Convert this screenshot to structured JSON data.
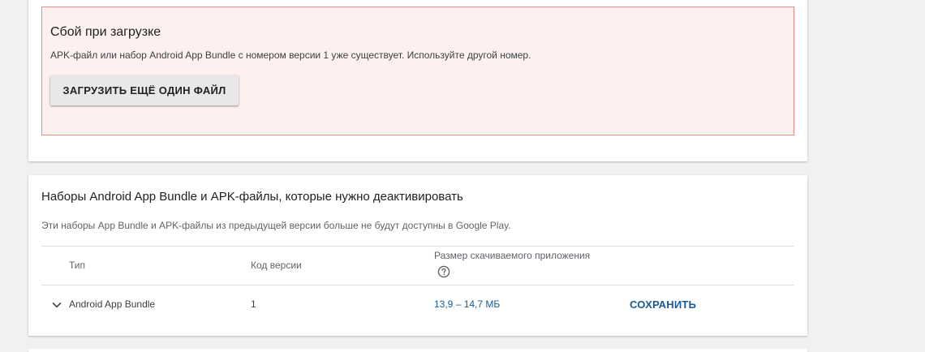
{
  "error": {
    "title": "Сбой при загрузке",
    "message": "APK-файл или набор Android App Bundle с номером версии 1 уже существует. Используйте другой номер.",
    "upload_button_label": "ЗАГРУЗИТЬ ЕЩЁ ОДИН ФАЙЛ",
    "border_color": "#e88d87",
    "background_color": "#fdf0ef"
  },
  "deactivate_section": {
    "title": "Наборы Android App Bundle и APK-файлы, которые нужно деактивировать",
    "description": "Эти наборы App Bundle и APK-файлы из предыдущей версии больше не будут доступны в Google Play.",
    "columns": {
      "type": "Тип",
      "version_code": "Код версии",
      "download_size": "Размер скачиваемого приложения"
    },
    "help_icon": "help-circle-icon",
    "rows": [
      {
        "type": "Android App Bundle",
        "version_code": "1",
        "download_size": "13,9 – 14,7 МБ",
        "action": "СОХРАНИТЬ",
        "expand_icon": "chevron-down-icon"
      }
    ]
  },
  "colors": {
    "link": "#1a5a9a",
    "page_background": "#f1f1f1"
  }
}
